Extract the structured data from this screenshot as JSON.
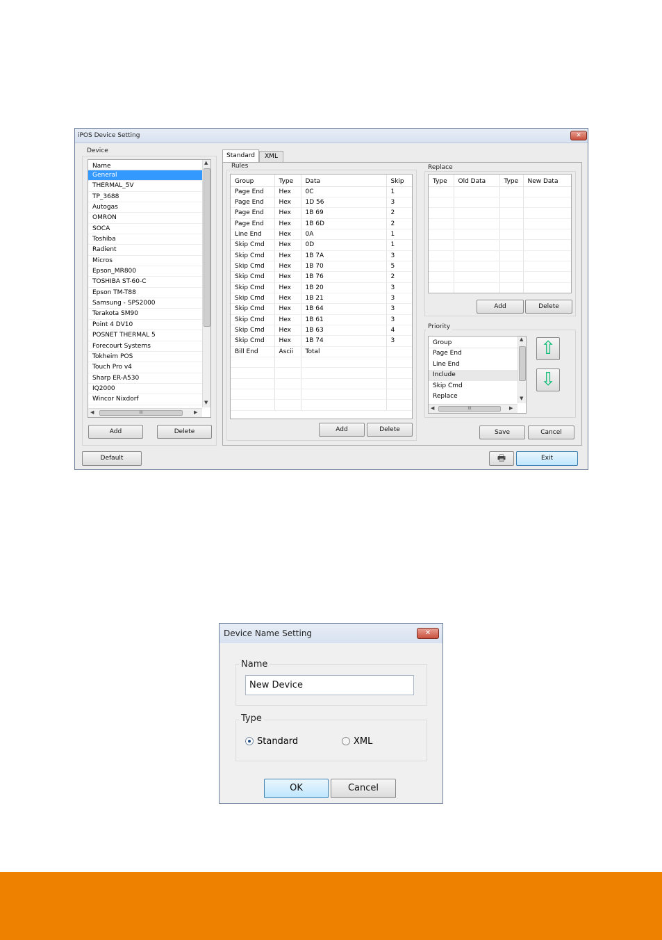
{
  "main_window": {
    "title": "iPOS Device Setting",
    "close_glyph": "✕",
    "device_group_label": "Device",
    "device_list": {
      "header": "Name",
      "items": [
        "General",
        "THERMAL_5V",
        "TP_3688",
        "Autogas",
        "OMRON",
        "SOCA",
        "Toshiba",
        "Radient",
        "Micros",
        "Epson_MR800",
        "TOSHIBA ST-60-C",
        "Epson TM-T88",
        "Samsung - SPS2000",
        "Terakota SM90",
        "Point 4 DV10",
        "POSNET THERMAL 5",
        "Forecourt Systems",
        "Tokheim POS",
        "Touch Pro v4",
        "Sharp ER-A530",
        "IQ2000",
        "Wincor Nixdorf"
      ],
      "selected_index": 0,
      "hscroll_glyph": "III"
    },
    "device_add": "Add",
    "device_delete": "Delete",
    "tabs": [
      "Standard",
      "XML"
    ],
    "active_tab": "Standard",
    "rules": {
      "label": "Rules",
      "columns": [
        "Group",
        "Type",
        "Data",
        "Skip"
      ],
      "rows": [
        [
          "Page End",
          "Hex",
          "0C",
          "1"
        ],
        [
          "Page End",
          "Hex",
          "1D 56",
          "3"
        ],
        [
          "Page End",
          "Hex",
          "1B 69",
          "2"
        ],
        [
          "Page End",
          "Hex",
          "1B 6D",
          "2"
        ],
        [
          "Line End",
          "Hex",
          "0A",
          "1"
        ],
        [
          "Skip Cmd",
          "Hex",
          "0D",
          "1"
        ],
        [
          "Skip Cmd",
          "Hex",
          "1B 7A",
          "3"
        ],
        [
          "Skip Cmd",
          "Hex",
          "1B 70",
          "5"
        ],
        [
          "Skip Cmd",
          "Hex",
          "1B 76",
          "2"
        ],
        [
          "Skip Cmd",
          "Hex",
          "1B 20",
          "3"
        ],
        [
          "Skip Cmd",
          "Hex",
          "1B 21",
          "3"
        ],
        [
          "Skip Cmd",
          "Hex",
          "1B 64",
          "3"
        ],
        [
          "Skip Cmd",
          "Hex",
          "1B 61",
          "3"
        ],
        [
          "Skip Cmd",
          "Hex",
          "1B 63",
          "4"
        ],
        [
          "Skip Cmd",
          "Hex",
          "1B 74",
          "3"
        ],
        [
          "Bill End",
          "Ascii",
          "Total",
          ""
        ]
      ],
      "add": "Add",
      "delete": "Delete"
    },
    "replace": {
      "label": "Replace",
      "columns": [
        "Type",
        "Old Data",
        "Type",
        "New Data"
      ],
      "add": "Add",
      "delete": "Delete"
    },
    "priority": {
      "label": "Priority",
      "header": "Group",
      "items": [
        "Page End",
        "Line End",
        "Include",
        "Skip Cmd",
        "Replace"
      ],
      "highlighted_index": 2,
      "up_glyph": "⇧",
      "down_glyph": "⇩",
      "hscroll_glyph": "III"
    },
    "save": "Save",
    "cancel": "Cancel",
    "default": "Default",
    "exit": "Exit",
    "printer_glyph": "🖶"
  },
  "name_dialog": {
    "title": "Device Name Setting",
    "close_glyph": "✕",
    "name_label": "Name",
    "name_value": "New Device",
    "type_label": "Type",
    "radio_standard": "Standard",
    "radio_xml": "XML",
    "selected_type": "Standard",
    "ok": "OK",
    "cancel": "Cancel"
  },
  "colors": {
    "selection": "#3399ff",
    "accent_bar": "#ee8100",
    "arrow_fill": "#33dd99"
  }
}
